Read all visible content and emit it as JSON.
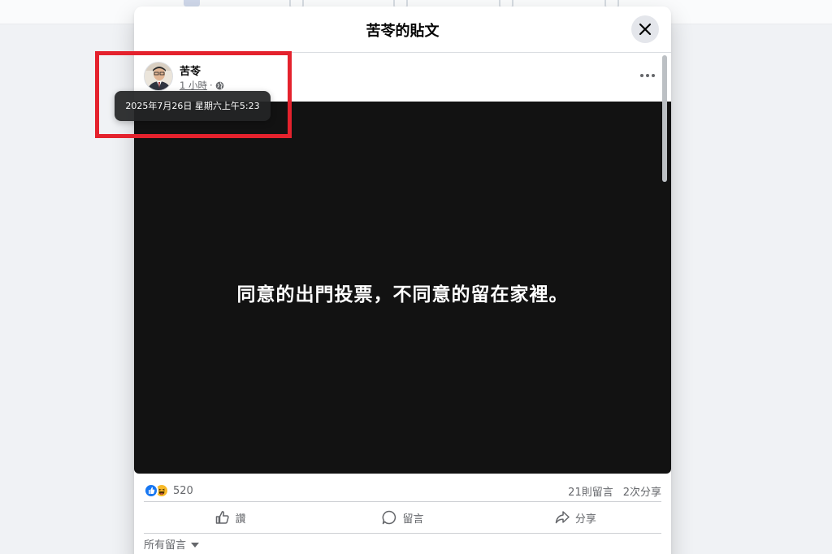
{
  "modal": {
    "title": "苦苓的貼文"
  },
  "post": {
    "author": "苦苓",
    "time_ago": "1 小時",
    "separator": "·",
    "tooltip": "2025年7月26日 星期六上午5:23",
    "image_text": "同意的出門投票，不同意的留在家裡。"
  },
  "stats": {
    "reaction_count": "520",
    "comments": "21則留言",
    "shares": "2次分享"
  },
  "actions": {
    "like": "讚",
    "comment": "留言",
    "share": "分享"
  },
  "comments": {
    "filter": "所有留言"
  },
  "colors": {
    "highlight": "#e4222d",
    "like_blue": "#1877f2",
    "haha_yellow": "#f7b928"
  }
}
